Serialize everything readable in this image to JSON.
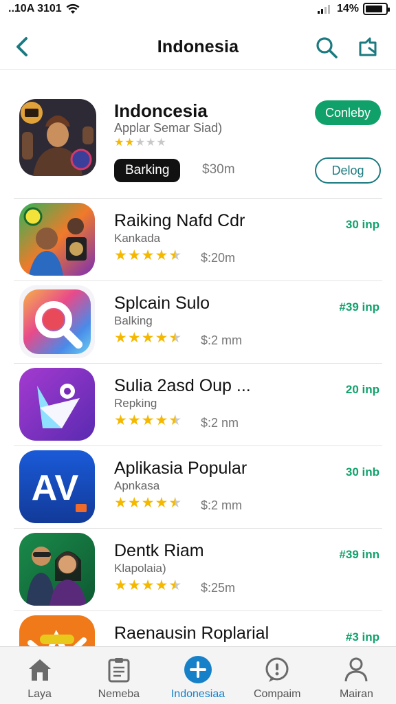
{
  "status_bar": {
    "time": "..10A 3101",
    "battery": "14%",
    "battery_level": 0.85
  },
  "header": {
    "title": "Indonesia"
  },
  "featured": {
    "title": "Indoncesia",
    "subtitle": "Applar  Semar Siad)",
    "rating": 2,
    "rank_label": "Barking",
    "price": "$30m",
    "primary_button": "Conleby",
    "secondary_button": "Delog",
    "icon": "character-icon"
  },
  "apps": [
    {
      "title": "Raiking Nafd Cdr",
      "subtitle": "Kankada",
      "rating": 4.5,
      "price": "$:20m",
      "size": "30 inp",
      "icon": "people-collage-icon"
    },
    {
      "title": "Splcain Sulo",
      "subtitle": "Balking",
      "rating": 4.5,
      "price": "$:2 mm",
      "size": "#39 inp",
      "icon": "magnifier-icon"
    },
    {
      "title": "Sulia 2asd Oup ...",
      "subtitle": "Repking",
      "rating": 4.5,
      "price": "$:2 nm",
      "size": "20 inp",
      "icon": "play-store-icon"
    },
    {
      "title": "Aplikasia Popular",
      "subtitle": "Apnkasa",
      "rating": 4.5,
      "price": "$:2 mm",
      "size": "30 inb",
      "icon": "av-letters-icon"
    },
    {
      "title": "Dentk Riam",
      "subtitle": "Klapolaia)",
      "rating": 4.5,
      "price": "$:25m",
      "size": "#39 inn",
      "icon": "people-photo-icon"
    },
    {
      "title": "Raenausin Roplarial",
      "subtitle": "",
      "rating": 0,
      "price": "",
      "size": "#3 inp",
      "icon": "orange-app-icon"
    }
  ],
  "tabs": [
    {
      "label": "Laya",
      "icon": "home-icon",
      "active": false
    },
    {
      "label": "Nemeba",
      "icon": "clipboard-icon",
      "active": false
    },
    {
      "label": "Indonesiaa",
      "icon": "plus-circle-icon",
      "active": true
    },
    {
      "label": "Compaim",
      "icon": "chat-icon",
      "active": false
    },
    {
      "label": "Mairan",
      "icon": "person-icon",
      "active": false
    }
  ],
  "colors": {
    "accent_green": "#10a16b",
    "accent_teal": "#1b7a7f",
    "tab_active": "#1680c8",
    "star": "#f5b800"
  }
}
